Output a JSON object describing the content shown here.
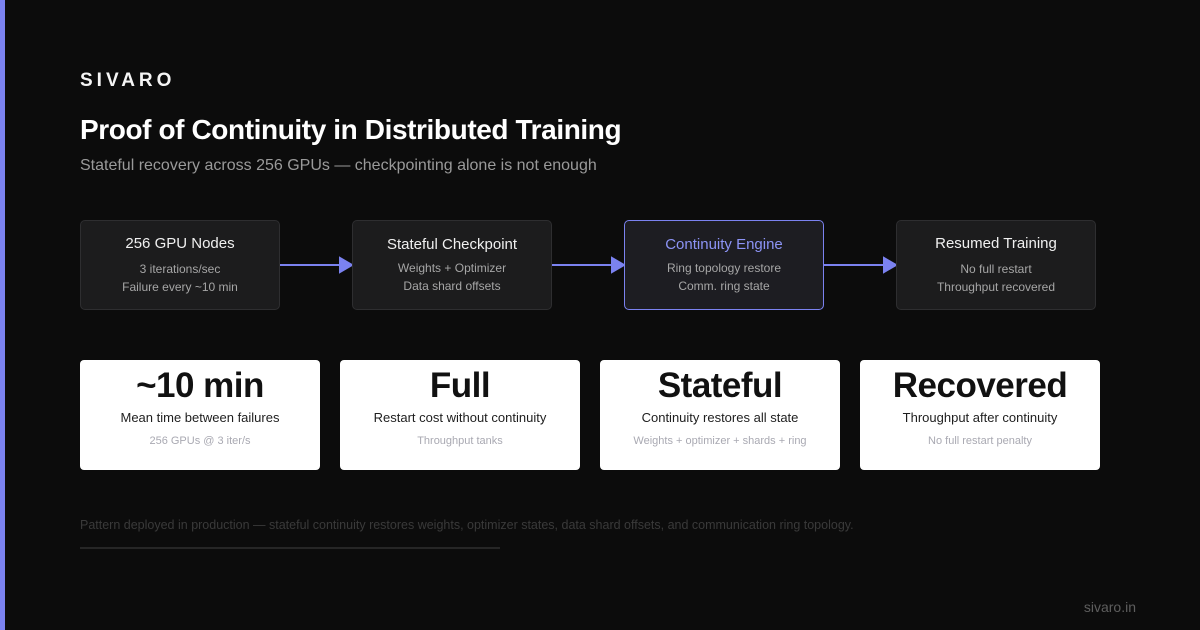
{
  "brand": "SIVARO",
  "title": "Proof of Continuity in Distributed Training",
  "subtitle": "Stateful recovery across 256 GPUs — checkpointing alone is not enough",
  "flow": {
    "nodes": [
      {
        "title": "256 GPU Nodes",
        "lines": [
          "3 iterations/sec",
          "Failure every ~10 min"
        ]
      },
      {
        "title": "Stateful Checkpoint",
        "lines": [
          "Weights + Optimizer",
          "Data shard offsets"
        ]
      },
      {
        "title": "Continuity Engine",
        "lines": [
          "Ring topology restore",
          "Comm. ring state"
        ]
      },
      {
        "title": "Resumed Training",
        "lines": [
          "No full restart",
          "Throughput recovered"
        ]
      }
    ]
  },
  "stats": [
    {
      "value": "~10 min",
      "label": "Mean time between failures",
      "note": "256 GPUs @ 3 iter/s"
    },
    {
      "value": "Full",
      "label": "Restart cost without continuity",
      "note": "Throughput tanks"
    },
    {
      "value": "Stateful",
      "label": "Continuity restores all state",
      "note": "Weights + optimizer + shards + ring"
    },
    {
      "value": "Recovered",
      "label": "Throughput after continuity",
      "note": "No full restart penalty"
    }
  ],
  "footer_note": "Pattern deployed in production — stateful continuity restores weights, optimizer states, data shard offsets, and communication ring topology.",
  "site": "sivaro.in",
  "colors": {
    "accent": "#7b82f0",
    "background": "#0c0c0c",
    "card": "#ffffff",
    "node": "#1c1c1d"
  }
}
